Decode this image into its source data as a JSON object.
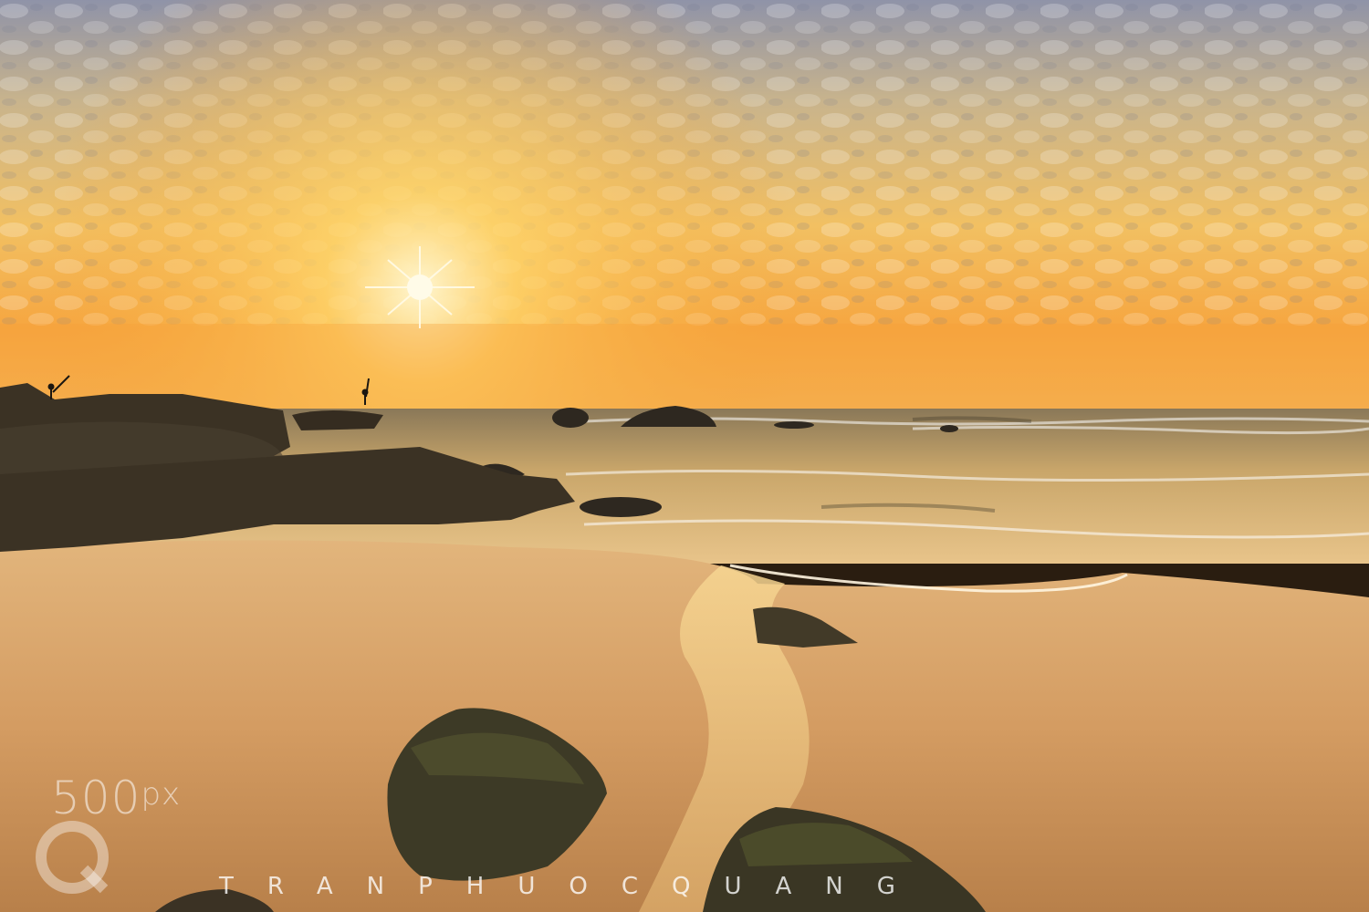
{
  "photo": {
    "subject": "beach-sunset",
    "colors": {
      "sky_top": "#8a8fa6",
      "sky_glow": "#f5b53a",
      "horizon": "#f6a13a",
      "sea": "#a98a58",
      "sand": "#d9a468",
      "rock": "#3b3224"
    }
  },
  "watermark": {
    "logo_text": "500",
    "logo_suffix": "px",
    "signature": "TRANPHUOCQUANG"
  }
}
